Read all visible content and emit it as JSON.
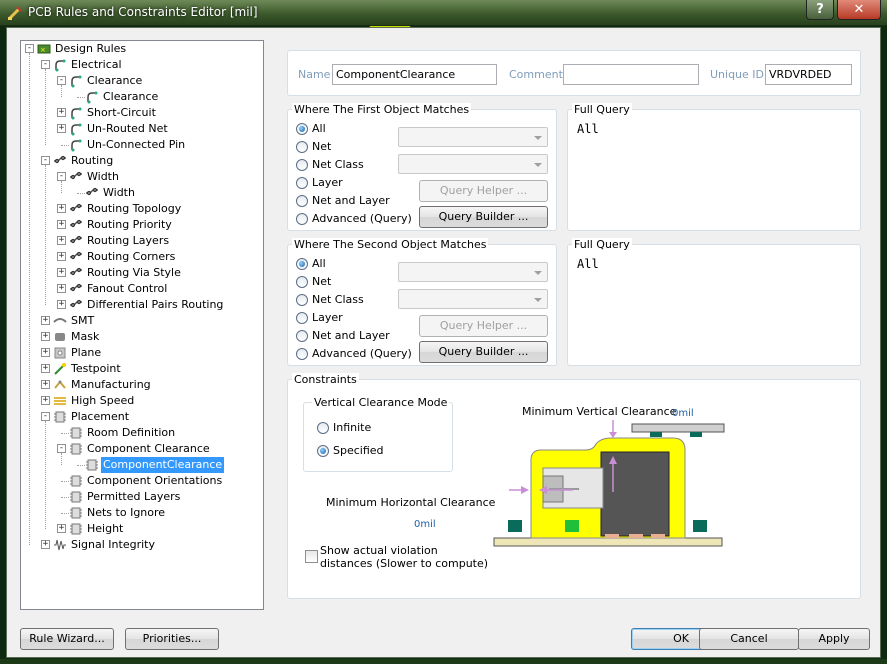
{
  "window": {
    "title": "PCB Rules and Constraints Editor [mil]",
    "help_label": "?",
    "close_label": "✕"
  },
  "tree": {
    "items": [
      {
        "label": "Design Rules"
      },
      {
        "label": "Electrical"
      },
      {
        "label": "Clearance"
      },
      {
        "label": "Clearance"
      },
      {
        "label": "Short-Circuit"
      },
      {
        "label": "Un-Routed Net"
      },
      {
        "label": "Un-Connected Pin"
      },
      {
        "label": "Routing"
      },
      {
        "label": "Width"
      },
      {
        "label": "Width"
      },
      {
        "label": "Routing Topology"
      },
      {
        "label": "Routing Priority"
      },
      {
        "label": "Routing Layers"
      },
      {
        "label": "Routing Corners"
      },
      {
        "label": "Routing Via Style"
      },
      {
        "label": "Fanout Control"
      },
      {
        "label": "Differential Pairs Routing"
      },
      {
        "label": "SMT"
      },
      {
        "label": "Mask"
      },
      {
        "label": "Plane"
      },
      {
        "label": "Testpoint"
      },
      {
        "label": "Manufacturing"
      },
      {
        "label": "High Speed"
      },
      {
        "label": "Placement"
      },
      {
        "label": "Room Definition"
      },
      {
        "label": "Component Clearance"
      },
      {
        "label": "ComponentClearance"
      },
      {
        "label": "Component Orientations"
      },
      {
        "label": "Permitted Layers"
      },
      {
        "label": "Nets to Ignore"
      },
      {
        "label": "Height"
      },
      {
        "label": "Signal Integrity"
      }
    ]
  },
  "rule": {
    "name_label": "Name",
    "name_value": "ComponentClearance",
    "comment_label": "Comment",
    "comment_value": "",
    "uid_label": "Unique ID",
    "uid_value": "VRDVRDED"
  },
  "first_match": {
    "title": "Where The First Object Matches",
    "options": [
      "All",
      "Net",
      "Net Class",
      "Layer",
      "Net and Layer",
      "Advanced (Query)"
    ],
    "selected": "All",
    "query_helper_label": "Query Helper ...",
    "query_builder_label": "Query Builder ...",
    "full_query_title": "Full Query",
    "full_query_text": "All"
  },
  "second_match": {
    "title": "Where The Second Object Matches",
    "options": [
      "All",
      "Net",
      "Net Class",
      "Layer",
      "Net and Layer",
      "Advanced (Query)"
    ],
    "selected": "All",
    "query_helper_label": "Query Helper ...",
    "query_builder_label": "Query Builder ...",
    "full_query_title": "Full Query",
    "full_query_text": "All"
  },
  "constraints": {
    "title": "Constraints",
    "mode_title": "Vertical Clearance Mode",
    "mode_options": [
      "Infinite",
      "Specified"
    ],
    "mode_selected": "Specified",
    "min_vertical_label": "Minimum Vertical Clearance",
    "min_vertical_value": "0mil",
    "min_horizontal_label": "Minimum Horizontal Clearance",
    "min_horizontal_value": "0mil",
    "show_violation_label_1": "Show actual violation",
    "show_violation_label_2": "distances (Slower to compute)",
    "show_violation_checked": false
  },
  "footer": {
    "rule_wizard_label": "Rule Wizard...",
    "priorities_label": "Priorities...",
    "ok_label": "OK",
    "cancel_label": "Cancel",
    "apply_label": "Apply"
  },
  "colors": {
    "selection": "#3399ff",
    "titlebar": "#3c5a2c",
    "blue_value": "#1f5fa6",
    "clearance_zone": "#ffff00",
    "component_body": "#555555",
    "pad_green": "#0a6b5a"
  }
}
